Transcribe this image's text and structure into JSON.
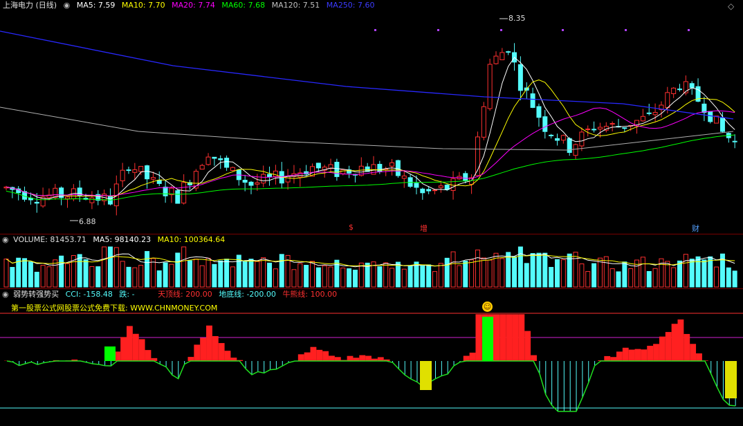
{
  "colors": {
    "up": "#ff3030",
    "down": "#54fcfc",
    "ma5": "#ffffff",
    "ma10": "#ffff00",
    "ma20": "#ff00ff",
    "ma60": "#00ff00",
    "ma120": "#b0b0b0",
    "ma250": "#2828ff",
    "cci_pos": "#ff2020",
    "cci_neg": "#54fcfc"
  },
  "main_pane": {
    "title": "上海电力 (日线)",
    "ma": [
      {
        "label": "MA5: 7.59",
        "color": "#ffffff"
      },
      {
        "label": "MA10: 7.70",
        "color": "#ffff00"
      },
      {
        "label": "MA20: 7.74",
        "color": "#ff00ff"
      },
      {
        "label": "MA60: 7.68",
        "color": "#00ff00"
      },
      {
        "label": "MA120: 7.51",
        "color": "#c0c0c0"
      },
      {
        "label": "MA250: 7.60",
        "color": "#3b3bff"
      }
    ],
    "high_label": "8.35",
    "low_label": "6.88",
    "markers": [
      {
        "text": "$",
        "color": "#ff3030"
      },
      {
        "text": "增",
        "color": "#ff3030"
      },
      {
        "text": "财",
        "color": "#54a0ff"
      }
    ]
  },
  "volume_pane": {
    "label": "VOLUME: 81453.71",
    "ma5": "MA5: 98140.23",
    "ma10": "MA10: 100364.64"
  },
  "indicator_pane": {
    "name": "弱势转强势买",
    "cci": "CCI: -158.48",
    "status": "跌: -",
    "top_line": "天顶线: 200.00",
    "bottom_line": "地底线: -200.00",
    "bull_line": "牛熊线: 100.00",
    "promo": "第一股票公式网股票公式免费下载: WWW.CHNMONEY.COM"
  },
  "icons": [
    "diamond-icon",
    "collapse-icon",
    "smiley-icon"
  ]
}
